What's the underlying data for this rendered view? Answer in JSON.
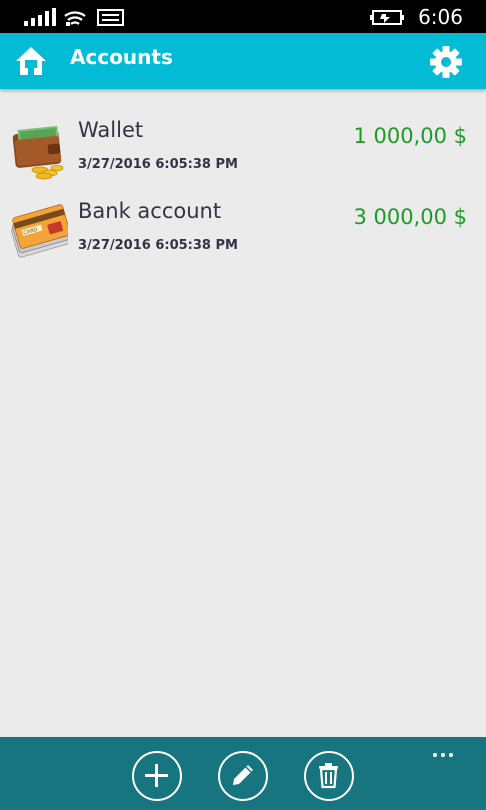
{
  "status_bar": {
    "time": "6:06",
    "icons": [
      "signal-icon",
      "wifi-icon",
      "message-icon",
      "battery-charging-icon"
    ]
  },
  "app_bar": {
    "title": "Accounts",
    "home_icon": "home-icon",
    "settings_icon": "gear-icon",
    "background": "#04bbd6"
  },
  "accounts": [
    {
      "name": "Wallet",
      "date": "3/27/2016 6:05:38 PM",
      "amount": "1 000,00 $",
      "icon": "wallet-icon"
    },
    {
      "name": "Bank account",
      "date": "3/27/2016 6:05:38 PM",
      "amount": "3 000,00 $",
      "icon": "bank-card-icon"
    }
  ],
  "bottom_bar": {
    "background": "#177580",
    "buttons": [
      {
        "name": "add",
        "icon": "plus-icon"
      },
      {
        "name": "edit",
        "icon": "pencil-icon"
      },
      {
        "name": "delete",
        "icon": "trash-icon"
      }
    ],
    "more_icon": "ellipsis-icon"
  },
  "colors": {
    "amount": "#1e9a27",
    "text": "#333344",
    "page_background": "#ebebeb"
  }
}
